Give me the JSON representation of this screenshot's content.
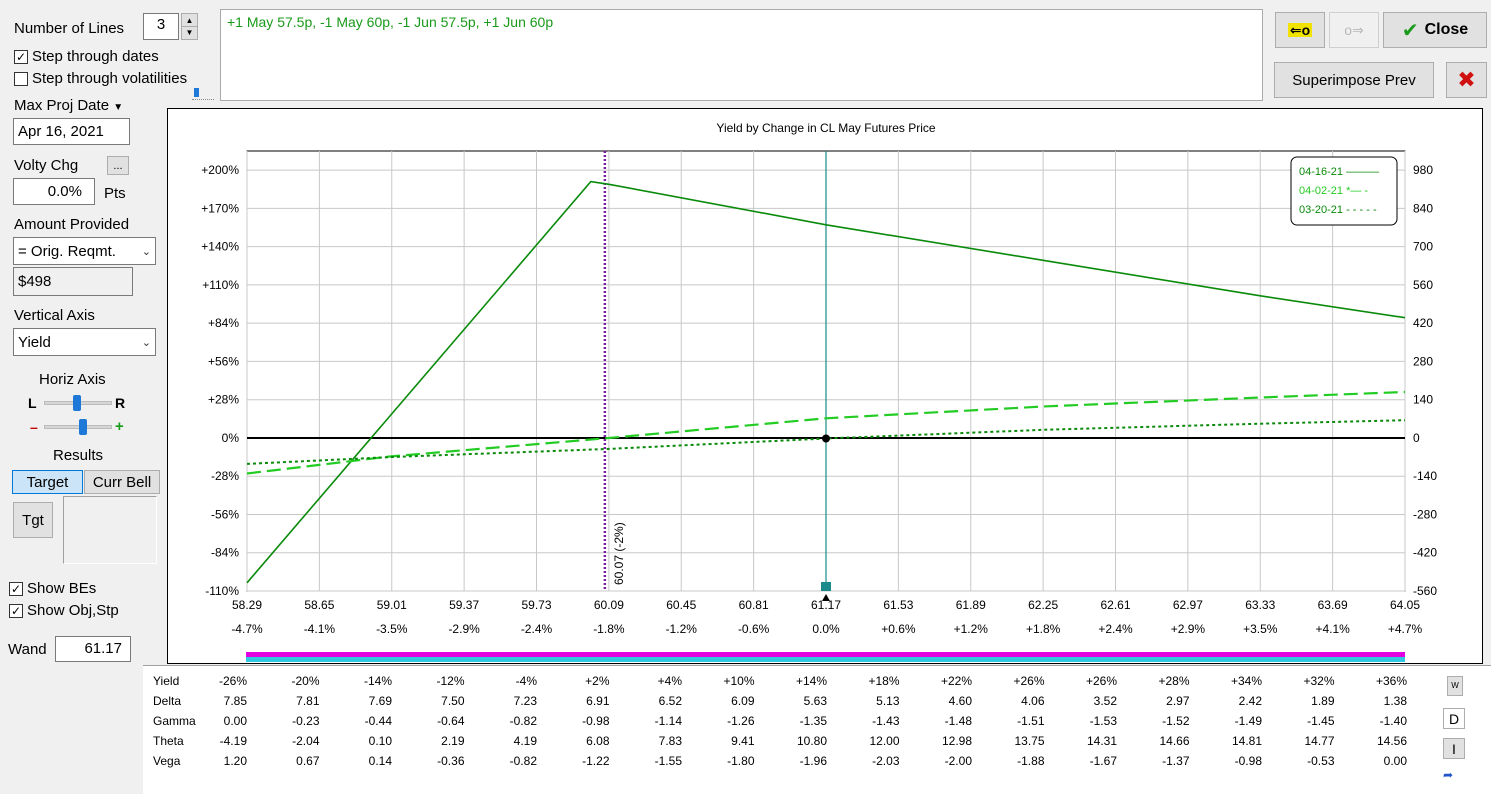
{
  "controls": {
    "num_lines_label": "Number of Lines",
    "num_lines_value": "3",
    "step_dates_label": "Step through dates",
    "step_dates_checked": true,
    "step_vols_label": "Step through volatilities",
    "step_vols_checked": false,
    "max_proj_label": "Max Proj Date",
    "max_proj_value": "Apr 16, 2021",
    "volty_label": "Volty Chg",
    "volty_btn": "...",
    "volty_value": "0.0%",
    "volty_unit": "Pts",
    "amount_label": "Amount Provided",
    "amount_select": "= Orig. Reqmt.",
    "amount_value": "$498",
    "vaxis_label": "Vertical Axis",
    "vaxis_select": "Yield",
    "horiz_label": "Horiz Axis",
    "horiz_l": "L",
    "horiz_r": "R",
    "zoom_minus": "–",
    "zoom_plus": "+",
    "results_label": "Results",
    "target_btn": "Target",
    "currbell_btn": "Curr Bell",
    "tgt_btn": "Tgt",
    "show_bes_label": "Show BEs",
    "show_bes_checked": true,
    "show_obj_label": "Show Obj,Stp",
    "show_obj_checked": true,
    "wand_label": "Wand",
    "wand_value": "61.17"
  },
  "position_text": "+1 May 57.5p, -1 May 60p, -1 Jun 57.5p, +1 Jun 60p",
  "topright": {
    "close_label": "Close",
    "superimpose_label": "Superimpose Prev"
  },
  "colors": {
    "solid_line": "#0a8a0a",
    "dashed_line": "#22cc22",
    "dotted_line": "#0a8a0a",
    "marker_line": "#7b1fa2",
    "wand_line": "#1a8a8a",
    "bar_magenta": "#e000e0",
    "bar_cyan": "#30c8e0"
  },
  "chart_data": {
    "type": "line",
    "title": "Yield by Change in CL May Futures Price",
    "x_ticks": [
      "58.29",
      "58.65",
      "59.01",
      "59.37",
      "59.73",
      "60.09",
      "60.45",
      "60.81",
      "61.17",
      "61.53",
      "61.89",
      "62.25",
      "62.61",
      "62.97",
      "63.33",
      "63.69",
      "64.05"
    ],
    "x_pct_ticks": [
      "-4.7%",
      "-4.1%",
      "-3.5%",
      "-2.9%",
      "-2.4%",
      "-1.8%",
      "-1.2%",
      "-0.6%",
      "0.0%",
      "+0.6%",
      "+1.2%",
      "+1.8%",
      "+2.4%",
      "+2.9%",
      "+3.5%",
      "+4.1%",
      "+4.7%"
    ],
    "y_left_ticks": [
      "+200%",
      "+170%",
      "+140%",
      "+110%",
      "+84%",
      "+56%",
      "+28%",
      "0%",
      "-28%",
      "-56%",
      "-84%",
      "-110%"
    ],
    "y_right_ticks": [
      "980",
      "840",
      "700",
      "560",
      "420",
      "280",
      "140",
      "0",
      "-140",
      "-280",
      "-420",
      "-560"
    ],
    "ylim": [
      -560,
      1050
    ],
    "xlim": [
      58.29,
      64.05
    ],
    "grid": true,
    "legend_position": "top-right",
    "series": [
      {
        "name": "04-16-21",
        "legend_suffix": "———",
        "style": "solid",
        "points": [
          [
            58.29,
            -530
          ],
          [
            60.0,
            938
          ],
          [
            60.09,
            928
          ],
          [
            61.17,
            780
          ],
          [
            62.25,
            650
          ],
          [
            63.33,
            520
          ],
          [
            64.05,
            440
          ]
        ]
      },
      {
        "name": "04-02-21",
        "legend_suffix": "*— -",
        "style": "dashed",
        "points": [
          [
            58.29,
            -130
          ],
          [
            59.0,
            -68
          ],
          [
            60.09,
            0
          ],
          [
            61.17,
            72
          ],
          [
            62.25,
            115
          ],
          [
            63.33,
            148
          ],
          [
            64.05,
            168
          ]
        ]
      },
      {
        "name": "03-20-21",
        "legend_suffix": "- - - - -",
        "style": "dotted",
        "points": [
          [
            58.29,
            -95
          ],
          [
            59.0,
            -70
          ],
          [
            60.09,
            -40
          ],
          [
            61.17,
            -2
          ],
          [
            62.25,
            30
          ],
          [
            63.33,
            52
          ],
          [
            64.05,
            65
          ]
        ]
      }
    ],
    "vertical_marker": {
      "x": 60.07,
      "label": "60.07 (-2%)"
    },
    "wand_x": 61.17
  },
  "greeks": {
    "rows": [
      {
        "label": "Yield",
        "values": [
          "-26%",
          "-20%",
          "-14%",
          "-12%",
          "-4%",
          "+2%",
          "+4%",
          "+10%",
          "+14%",
          "+18%",
          "+22%",
          "+26%",
          "+26%",
          "+28%",
          "+34%",
          "+32%",
          "+36%"
        ]
      },
      {
        "label": "Delta",
        "values": [
          "7.85",
          "7.81",
          "7.69",
          "7.50",
          "7.23",
          "6.91",
          "6.52",
          "6.09",
          "5.63",
          "5.13",
          "4.60",
          "4.06",
          "3.52",
          "2.97",
          "2.42",
          "1.89",
          "1.38"
        ]
      },
      {
        "label": "Gamma",
        "values": [
          "0.00",
          "-0.23",
          "-0.44",
          "-0.64",
          "-0.82",
          "-0.98",
          "-1.14",
          "-1.26",
          "-1.35",
          "-1.43",
          "-1.48",
          "-1.51",
          "-1.53",
          "-1.52",
          "-1.49",
          "-1.45",
          "-1.40"
        ]
      },
      {
        "label": "Theta",
        "values": [
          "-4.19",
          "-2.04",
          "0.10",
          "2.19",
          "4.19",
          "6.08",
          "7.83",
          "9.41",
          "10.80",
          "12.00",
          "12.98",
          "13.75",
          "14.31",
          "14.66",
          "14.81",
          "14.77",
          "14.56"
        ]
      },
      {
        "label": "Vega",
        "values": [
          "1.20",
          "0.67",
          "0.14",
          "-0.36",
          "-0.82",
          "-1.22",
          "-1.55",
          "-1.80",
          "-1.96",
          "-2.03",
          "-2.00",
          "-1.88",
          "-1.67",
          "-1.37",
          "-0.98",
          "-0.53",
          "0.00"
        ]
      }
    ],
    "side_buttons": [
      "W",
      "D",
      "I"
    ]
  }
}
